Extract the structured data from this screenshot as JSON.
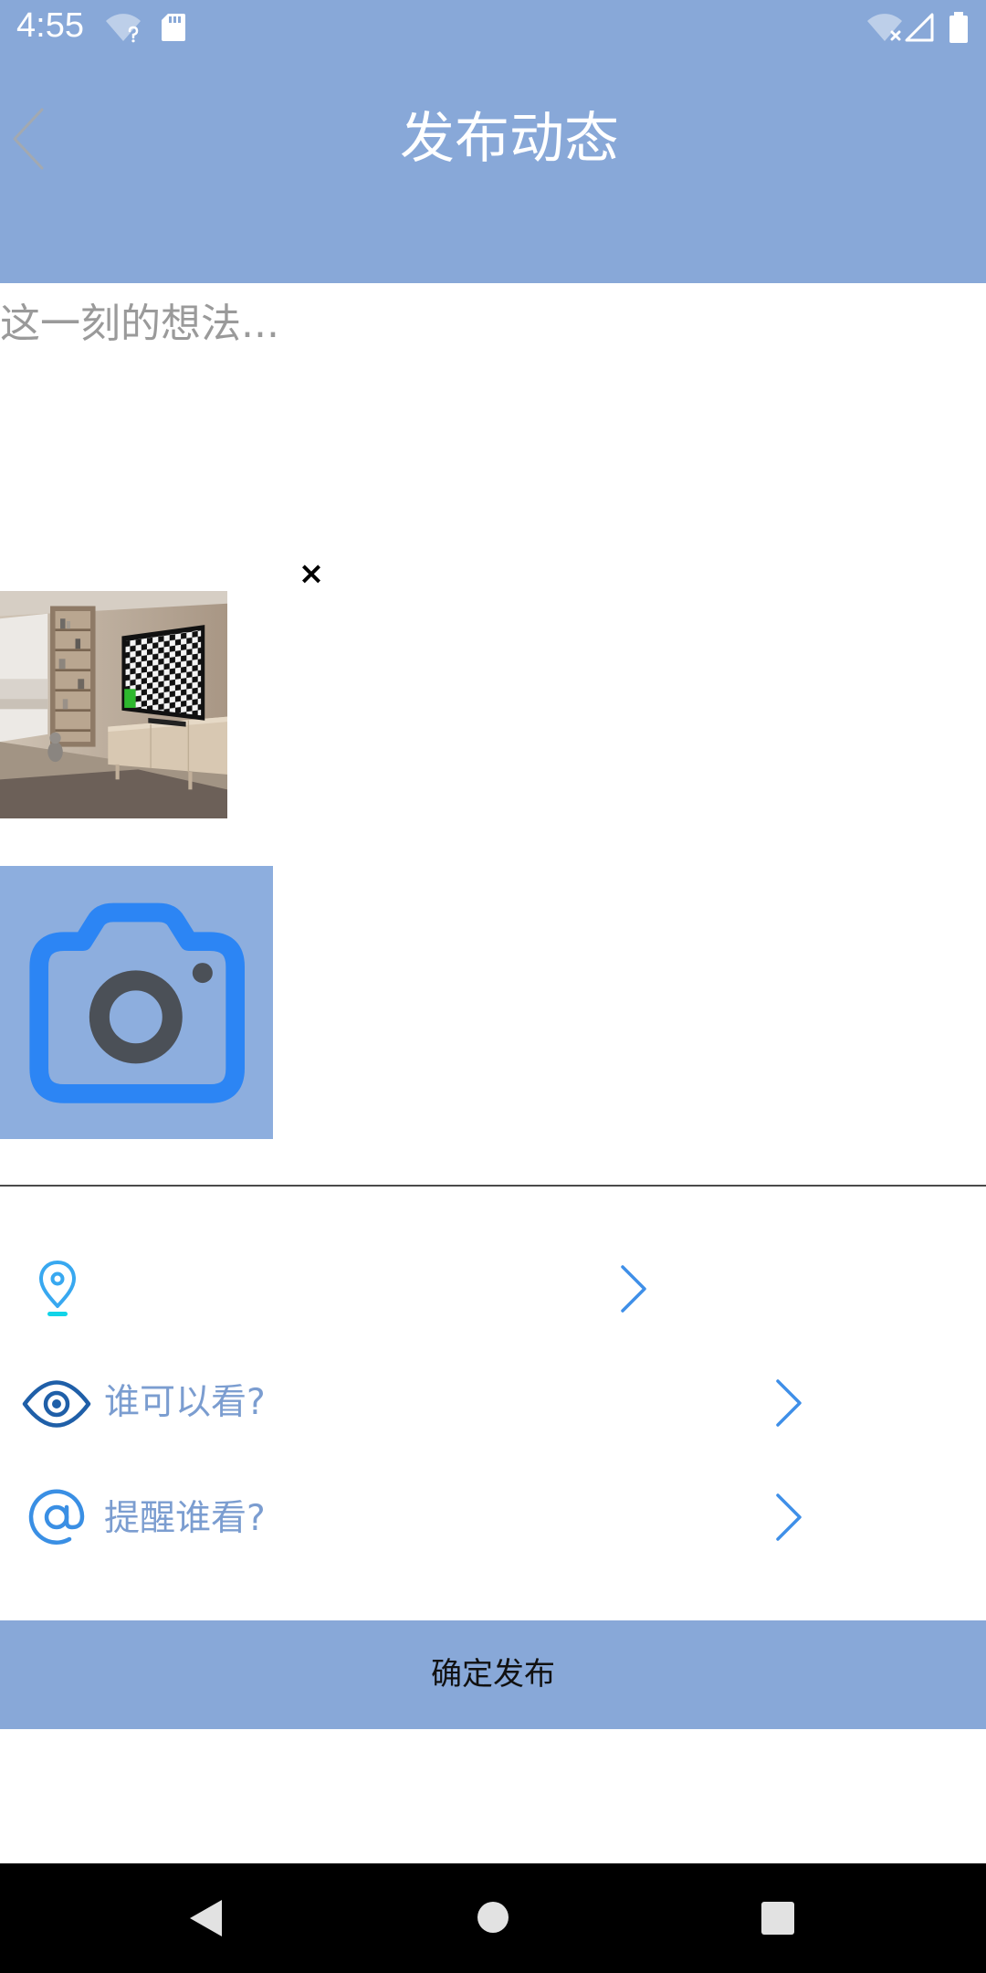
{
  "status_bar": {
    "time": "4:55",
    "icons": [
      "wifi-unknown-icon",
      "sd-card-icon",
      "wifi-off-icon",
      "cell-signal-icon",
      "battery-icon"
    ]
  },
  "header": {
    "title": "发布动态",
    "back_icon": "chevron-left-icon"
  },
  "compose": {
    "value": "",
    "placeholder": "这一刻的想法..."
  },
  "attachments": {
    "remove_glyph": "×",
    "add_photo_icon": "camera-icon"
  },
  "options": {
    "location": {
      "icon": "location-pin-icon"
    },
    "visibility": {
      "icon": "eye-icon",
      "label": "谁可以看?"
    },
    "mention": {
      "icon": "at-icon",
      "label": "提醒谁看?"
    },
    "chevron_icon": "chevron-right-icon"
  },
  "submit": {
    "label": "确定发布"
  },
  "nav_bar": {
    "icons": [
      "back-triangle-icon",
      "home-circle-icon",
      "recents-square-icon"
    ]
  },
  "colors": {
    "header_bg": "#88A8D8",
    "add_photo_bg": "#8DAEDE",
    "submit_bg": "#88A8D8",
    "camera_blue": "#2C85F4",
    "option_text": "#7B9DD0",
    "chevron_blue": "#3F8FE8",
    "placeholder_text": "#9A9A9A",
    "nav_bar_bg": "#000000"
  }
}
